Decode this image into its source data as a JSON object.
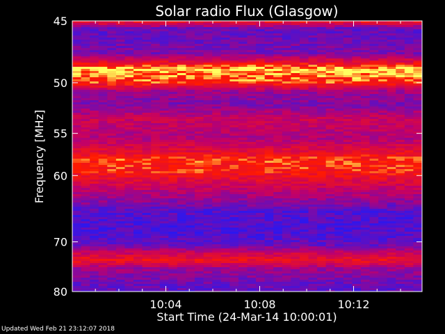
{
  "chart_data": {
    "type": "heatmap",
    "title": "Solar radio Flux (Glasgow)",
    "ylabel": "Frequency [MHz]",
    "xlabel": "Start Time (24-Mar-14 10:00:01)",
    "x_start": "10:00:01",
    "x_ticks": [
      "10:04",
      "10:08",
      "10:12"
    ],
    "y_ticks": [
      45,
      50,
      55,
      60,
      70,
      80
    ],
    "ylim": [
      45,
      80
    ],
    "y_scale": "reciprocal",
    "colors": {
      "background": "#000000",
      "low": "#1a1aff",
      "mid": "#c0006a",
      "high": "#ff1a00",
      "peak": "#ffff60"
    },
    "intensity_profile": [
      {
        "freq": 45.0,
        "level": 0.78
      },
      {
        "freq": 45.6,
        "level": 0.22
      },
      {
        "freq": 47.5,
        "level": 0.3
      },
      {
        "freq": 48.8,
        "level": 1.0
      },
      {
        "freq": 49.3,
        "level": 0.92
      },
      {
        "freq": 50.0,
        "level": 0.86
      },
      {
        "freq": 50.8,
        "level": 0.4
      },
      {
        "freq": 52.0,
        "level": 0.3
      },
      {
        "freq": 53.5,
        "level": 0.55
      },
      {
        "freq": 55.5,
        "level": 0.45
      },
      {
        "freq": 56.8,
        "level": 0.65
      },
      {
        "freq": 58.0,
        "level": 0.85
      },
      {
        "freq": 59.5,
        "level": 0.82
      },
      {
        "freq": 61.5,
        "level": 0.55
      },
      {
        "freq": 63.0,
        "level": 0.4
      },
      {
        "freq": 65.0,
        "level": 0.18
      },
      {
        "freq": 68.0,
        "level": 0.15
      },
      {
        "freq": 70.5,
        "level": 0.22
      },
      {
        "freq": 72.0,
        "level": 0.55
      },
      {
        "freq": 73.5,
        "level": 0.75
      },
      {
        "freq": 75.0,
        "level": 0.4
      },
      {
        "freq": 78.0,
        "level": 0.25
      },
      {
        "freq": 80.0,
        "level": 0.2
      }
    ]
  },
  "footer": "Updated Wed Feb 21 23:12:07 2018"
}
